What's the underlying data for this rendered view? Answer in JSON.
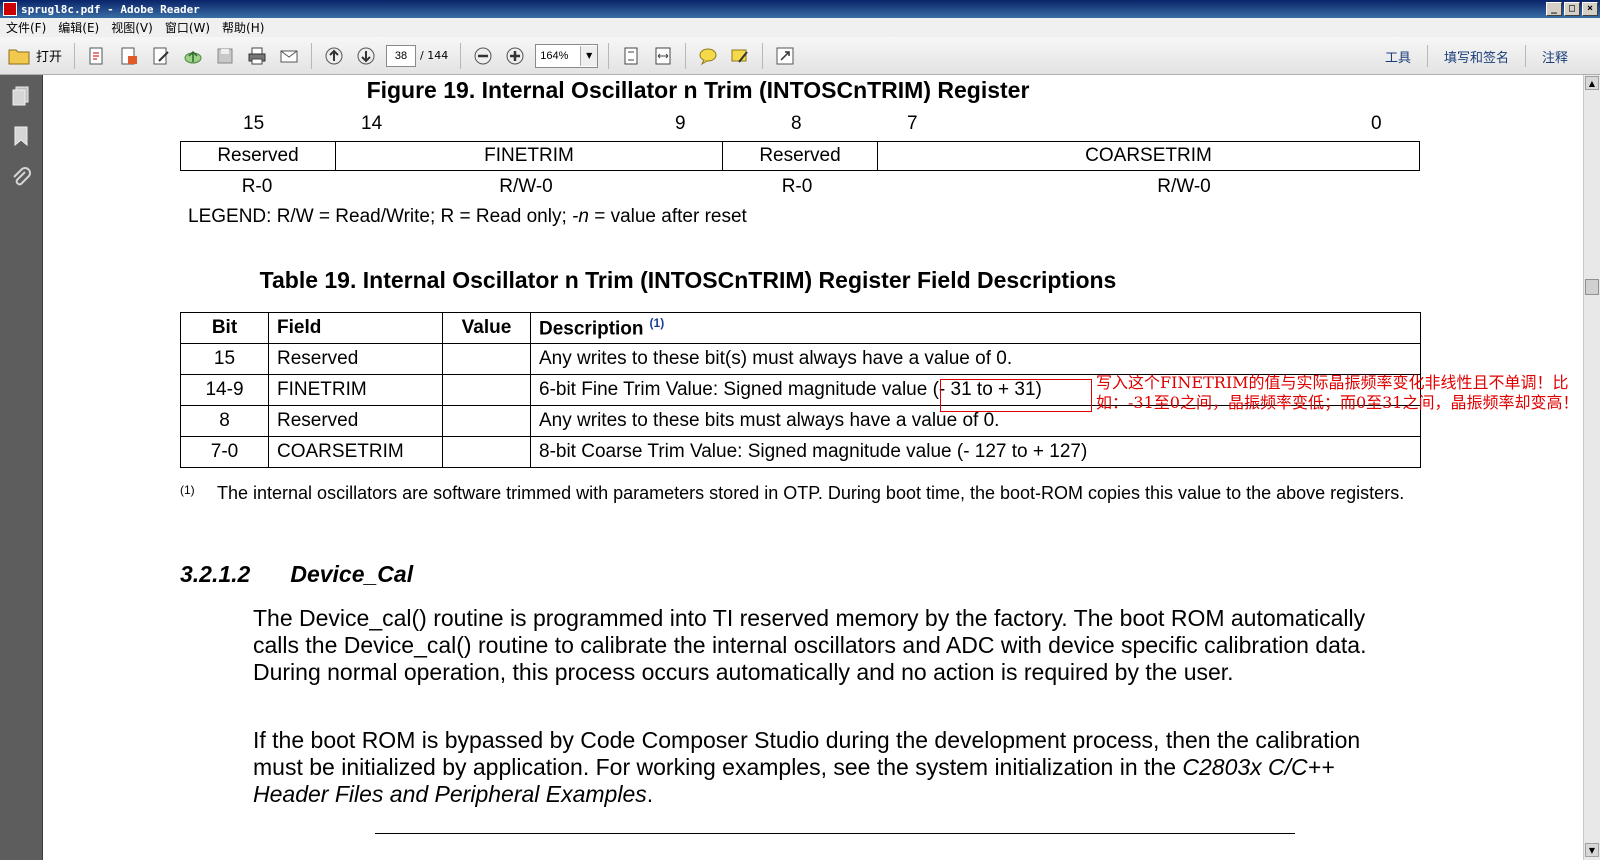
{
  "window": {
    "title": "sprugl8c.pdf - Adobe Reader",
    "buttons": [
      "_",
      "□",
      "×"
    ]
  },
  "menu": {
    "items": [
      "文件(F)",
      "编辑(E)",
      "视图(V)",
      "窗口(W)",
      "帮助(H)"
    ]
  },
  "toolbar": {
    "open_label": "打开",
    "page_current": "38",
    "page_total": "/ 144",
    "zoom_value": "164%",
    "zoom_dropdown": "▼",
    "links": [
      "工具",
      "填写和签名",
      "注释"
    ]
  },
  "document": {
    "figure_title": "Figure 19. Internal Oscillator n Trim (INTOSCnTRIM) Register",
    "bit_numbers": [
      "15",
      "14",
      "9",
      "8",
      "7",
      "0"
    ],
    "register_fields": [
      "Reserved",
      "FINETRIM",
      "Reserved",
      "COARSETRIM"
    ],
    "register_access": [
      "R-0",
      "R/W-0",
      "R-0",
      "R/W-0"
    ],
    "legend": {
      "prefix": "LEGEND: R/W = Read/Write; R = Read only; ",
      "n": "-n",
      "suffix": " = value after reset"
    },
    "table_title": "Table 19. Internal Oscillator n Trim (INTOSCnTRIM) Register Field Descriptions",
    "table": {
      "headers": [
        "Bit",
        "Field",
        "Value",
        "Description"
      ],
      "footnote_ref": "(1)",
      "rows": [
        [
          "15",
          "Reserved",
          "",
          "Any writes to these bit(s) must always have a value of 0."
        ],
        [
          "14-9",
          "FINETRIM",
          "",
          "6-bit Fine Trim Value: Signed magnitude value (- 31 to + 31)"
        ],
        [
          "8",
          "Reserved",
          "",
          "Any writes to these bits must always have a value of 0."
        ],
        [
          "7-0",
          "COARSETRIM",
          "",
          "8-bit Coarse Trim Value: Signed magnitude value (- 127 to + 127)"
        ]
      ]
    },
    "footnote": {
      "mark": "(1)",
      "text": "The internal oscillators are software trimmed with parameters stored in OTP. During boot time, the boot-ROM copies this value to the above registers."
    },
    "section": {
      "number": "3.2.1.2",
      "title": "Device_Cal"
    },
    "para1": "The Device_cal() routine is programmed into TI reserved memory by the factory. The boot ROM automatically calls the Device_cal() routine to calibrate the internal oscillators and ADC with device specific calibration data. During normal operation, this process occurs automatically and no action is required by the user.",
    "para2": {
      "text": "If the boot ROM is bypassed by Code Composer Studio during the development process, then the calibration must be initialized by application. For working examples, see the system initialization in the ",
      "italic": "C2803x C/C++ Header Files and Peripheral Examples",
      "end": "."
    }
  },
  "annotation": {
    "text": "写入这个FINETRIM的值与实际晶振频率变化非线性且不单调！比如：-31至0之间，晶振频率变低；而0至31之间，晶振频率却变高！",
    "color": "#e00000"
  }
}
